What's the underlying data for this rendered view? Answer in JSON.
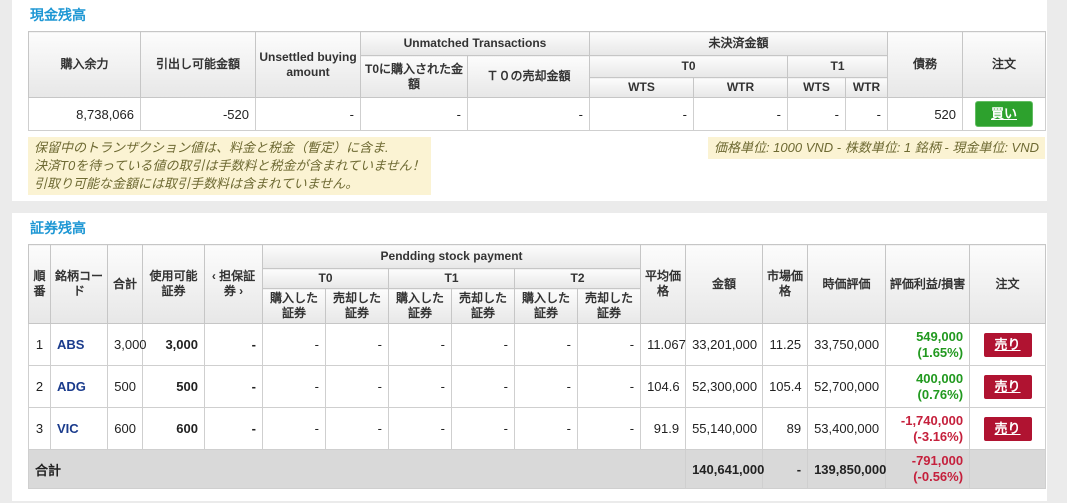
{
  "colors": {
    "title_blue": "#1e97d4",
    "buy_green": "#2da12d",
    "sell_red": "#b01331",
    "profit_green": "#21991f",
    "loss_red": "#c5203c",
    "note_bg": "#fbf3d3",
    "header_gray": "#e7e7e7",
    "total_row_gray": "#d9d9d9"
  },
  "cash": {
    "title": "現金残高",
    "headers": {
      "buying_power": "購入余力",
      "withdrawable": "引出し可能金額",
      "unsettled_buying": "Unsettled buying amount",
      "unmatched": "Unmatched Transactions",
      "t0_bought": "T0に購入された金額",
      "t0_sold": "Ｔ０の売却金額",
      "pending_amount": "未決済金額",
      "t0": "T0",
      "t1": "T1",
      "wts": "WTS",
      "wtr": "WTR",
      "debt": "債務",
      "order": "注文"
    },
    "row": {
      "buying_power": "8,738,066",
      "withdrawable": "-520",
      "unsettled_buying": "-",
      "t0_bought": "-",
      "t0_sold": "-",
      "t0_wts": "-",
      "t0_wtr": "-",
      "t1_wts": "-",
      "t1_wtr": "-",
      "debt": "520"
    },
    "buy_button": "買い",
    "notes": {
      "line1": "保留中のトランザクション値は、料金と税金（暫定）に含ま.",
      "line2": "決済T0を待っている値の取引は手数料と税金が含まれていません！",
      "line3": "引取り可能な金額には取引手数料は含まれていません。"
    },
    "units_note": "価格単位: 1000 VND - 株数単位: 1 銘柄 - 現金単位: VND"
  },
  "securities": {
    "title": "証券残高",
    "headers": {
      "no": "順番",
      "code": "銘柄コード",
      "total": "合計",
      "available": "使用可能証券",
      "collateral": "‹ 担保証券 ›",
      "pending": "Pendding stock payment",
      "t0": "T0",
      "t1": "T1",
      "t2": "T2",
      "bought": "購入した証券",
      "sold": "売却した証券",
      "avg_price": "平均価格",
      "amount": "金額",
      "market_price": "市場価格",
      "market_value": "時価評価",
      "profit_loss": "評価利益/損害",
      "order": "注文"
    },
    "sell_button": "売り",
    "rows": [
      {
        "no": "1",
        "code": "ABS",
        "total": "3,000",
        "available": "3,000",
        "collateral": "-",
        "t0_bought": "-",
        "t0_sold": "-",
        "t1_bought": "-",
        "t1_sold": "-",
        "t2_bought": "-",
        "t2_sold": "-",
        "avg_price": "11.067",
        "amount": "33,201,000",
        "market_price": "11.25",
        "market_value": "33,750,000",
        "pl_value": "549,000",
        "pl_pct": "(1.65%)"
      },
      {
        "no": "2",
        "code": "ADG",
        "total": "500",
        "available": "500",
        "collateral": "-",
        "t0_bought": "-",
        "t0_sold": "-",
        "t1_bought": "-",
        "t1_sold": "-",
        "t2_bought": "-",
        "t2_sold": "-",
        "avg_price": "104.6",
        "amount": "52,300,000",
        "market_price": "105.4",
        "market_value": "52,700,000",
        "pl_value": "400,000",
        "pl_pct": "(0.76%)"
      },
      {
        "no": "3",
        "code": "VIC",
        "total": "600",
        "available": "600",
        "collateral": "-",
        "t0_bought": "-",
        "t0_sold": "-",
        "t1_bought": "-",
        "t1_sold": "-",
        "t2_bought": "-",
        "t2_sold": "-",
        "avg_price": "91.9",
        "amount": "55,140,000",
        "market_price": "89",
        "market_value": "53,400,000",
        "pl_value": "-1,740,000",
        "pl_pct": "(-3.16%)"
      }
    ],
    "total": {
      "label": "合計",
      "amount": "140,641,000",
      "market_price": "-",
      "market_value": "139,850,000",
      "pl_value": "-791,000",
      "pl_pct": "(-0.56%)"
    }
  }
}
